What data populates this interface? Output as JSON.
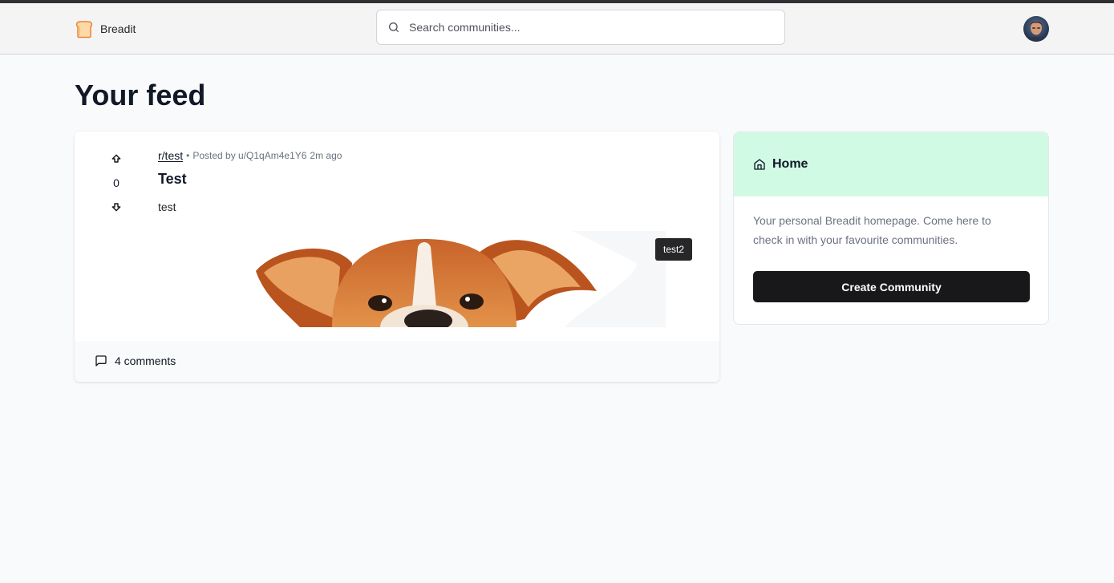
{
  "navbar": {
    "logo_text": "Breadit",
    "search_placeholder": "Search communities..."
  },
  "feed": {
    "title": "Your feed"
  },
  "post": {
    "subreddit": "r/test",
    "separator": "•",
    "posted_by": "Posted by u/Q1qAm4e1Y6",
    "time_ago": "2m ago",
    "title": "Test",
    "body": "test",
    "votes": "0",
    "image_tooltip": "test2",
    "comments": "4 comments"
  },
  "sidebar": {
    "title": "Home",
    "description": "Your personal Breadit homepage. Come here to check in with your favourite communities.",
    "create_button": "Create Community"
  },
  "colors": {
    "sidebar_header": "#d1fae5",
    "primary_button": "#18181b"
  }
}
